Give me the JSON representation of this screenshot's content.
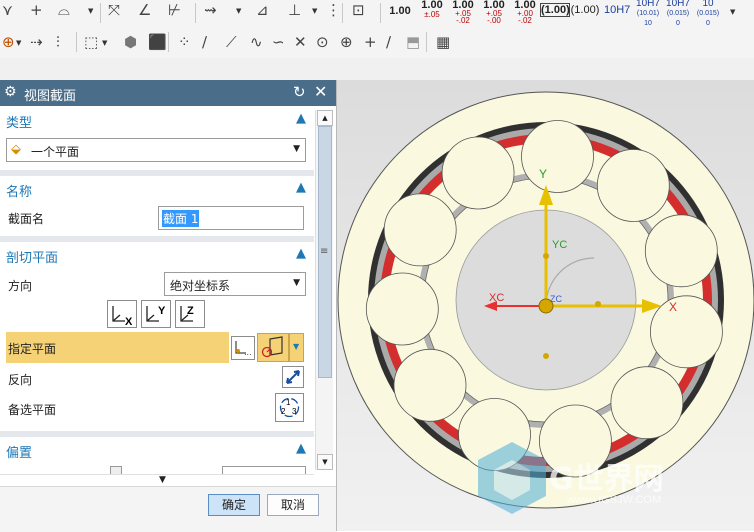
{
  "toolbar": {
    "dims": [
      "1.00",
      "1.00",
      "1.00",
      "1.00",
      "1.00",
      "(1.00)",
      "10H7"
    ],
    "tols": [
      [
        "±.05",
        ""
      ],
      [
        "+.05",
        "-.02"
      ],
      [
        "+.05",
        "-.00"
      ],
      [
        "+.00",
        "-.02"
      ]
    ],
    "fits": [
      [
        "10H7",
        "(10.01)",
        "10"
      ],
      [
        "10H7",
        "(0.015)",
        "0"
      ],
      [
        "10",
        "(0.015)",
        "0"
      ]
    ]
  },
  "dialog": {
    "title": "视图截面",
    "type_section": {
      "title": "类型",
      "value": "一个平面"
    },
    "name_section": {
      "title": "名称",
      "label": "截面名",
      "value": "截面 1"
    },
    "cut_section": {
      "title": "剖切平面",
      "direction_label": "方向",
      "direction_value": "绝对坐标系",
      "specify_plane_label": "指定平面",
      "reverse_label": "反向",
      "alternate_plane_label": "备选平面"
    },
    "offset_section": {
      "title": "偏置"
    },
    "ok_label": "确定",
    "cancel_label": "取消"
  },
  "viewport": {
    "axis_x_label": "X",
    "axis_y_label": "Y",
    "axis_xc_label": "XC",
    "axis_yc_label": "YC",
    "axis_zc_label": "ZC"
  },
  "watermark": {
    "text": "G世界网",
    "url": "www.UGSJW.COM"
  },
  "colors": {
    "title_bar": "#4a6e8a",
    "section_text": "#1e78b4",
    "highlight_row": "#f6d276",
    "bearing_fill": "#faf9df",
    "cage_red": "#d42d2d",
    "axis_yellow": "#e8c000",
    "axis_red": "#e83030"
  }
}
